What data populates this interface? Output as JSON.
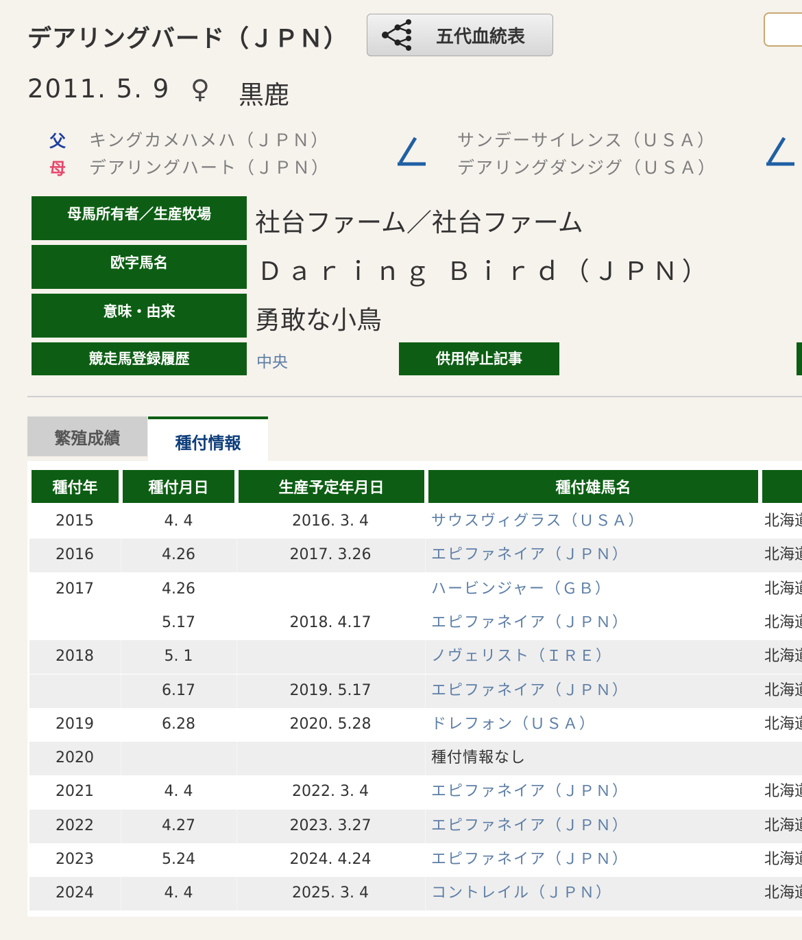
{
  "horse": {
    "name": "デアリングバード（ＪＰＮ）",
    "birth": "2011. 5. 9",
    "sex_symbol": "♀",
    "coat": "黒鹿"
  },
  "pedigree_button": {
    "label": "五代血統表"
  },
  "parents": {
    "sire_label": "父",
    "sire": "キングカメハメハ（ＪＰＮ）",
    "dam_label": "母",
    "dam": "デアリングハート（ＪＰＮ）",
    "broodmare_sire": "サンデーサイレンス（ＵＳＡ）",
    "broodmare_dam": "デアリングダンジグ（ＵＳＡ）"
  },
  "info": {
    "owner_label": "母馬所有者／生産牧場",
    "owner_value": "社台ファーム／社台ファーム",
    "roman_label": "欧字馬名",
    "roman_value": "Ｄａｒｉｎｇ Ｂｉｒｄ（ＪＰＮ）",
    "meaning_label": "意味・由来",
    "meaning_value": "勇敢な小鳥",
    "registry_label": "競走馬登録履歴",
    "registry_value": "中央",
    "suspension_button": "供用停止記事"
  },
  "tabs": [
    {
      "label": "繁殖成績",
      "active": false
    },
    {
      "label": "種付情報",
      "active": true
    }
  ],
  "table": {
    "headers": [
      "種付年",
      "種付月日",
      "生産予定年月日",
      "種付雄馬名"
    ],
    "rows": [
      {
        "year": "2015",
        "day": "4. 4",
        "due": "2016. 3. 4",
        "sire": "サウスヴィグラス（ＵＳＡ）",
        "loc": "北海道"
      },
      {
        "year": "2016",
        "day": "4.26",
        "due": "2017. 3.26",
        "sire": "エピファネイア（ＪＰＮ）",
        "loc": "北海道"
      },
      {
        "year": "2017",
        "day": "4.26",
        "due": "",
        "sire": "ハービンジャー（ＧＢ）",
        "loc": "北海道"
      },
      {
        "year": "",
        "day": "5.17",
        "due": "2018. 4.17",
        "sire": "エピファネイア（ＪＰＮ）",
        "loc": "北海道"
      },
      {
        "year": "2018",
        "day": "5. 1",
        "due": "",
        "sire": "ノヴェリスト（ＩＲＥ）",
        "loc": "北海道"
      },
      {
        "year": "",
        "day": "6.17",
        "due": "2019. 5.17",
        "sire": "エピファネイア（ＪＰＮ）",
        "loc": "北海道"
      },
      {
        "year": "2019",
        "day": "6.28",
        "due": "2020. 5.28",
        "sire": "ドレフォン（ＵＳＡ）",
        "loc": "北海道"
      },
      {
        "year": "2020",
        "day": "",
        "due": "",
        "sire": "種付情報なし",
        "loc": ""
      },
      {
        "year": "2021",
        "day": "4. 4",
        "due": "2022. 3. 4",
        "sire": "エピファネイア（ＪＰＮ）",
        "loc": "北海道"
      },
      {
        "year": "2022",
        "day": "4.27",
        "due": "2023. 3.27",
        "sire": "エピファネイア（ＪＰＮ）",
        "loc": "北海道"
      },
      {
        "year": "2023",
        "day": "5.24",
        "due": "2024. 4.24",
        "sire": "エピファネイア（ＪＰＮ）",
        "loc": "北海道"
      },
      {
        "year": "2024",
        "day": "4. 4",
        "due": "2025. 3. 4",
        "sire": "コントレイル（ＪＰＮ）",
        "loc": "北海道"
      }
    ]
  },
  "colors": {
    "green": "#0d5e14",
    "link": "#5d7ea6",
    "sire_label": "#1d3fa0",
    "dam_label": "#e8456b",
    "tab_active_text": "#0d3d7a"
  },
  "icons": {
    "pedigree": "pedigree-tree-icon",
    "connector": "pedigree-connector-icon"
  }
}
